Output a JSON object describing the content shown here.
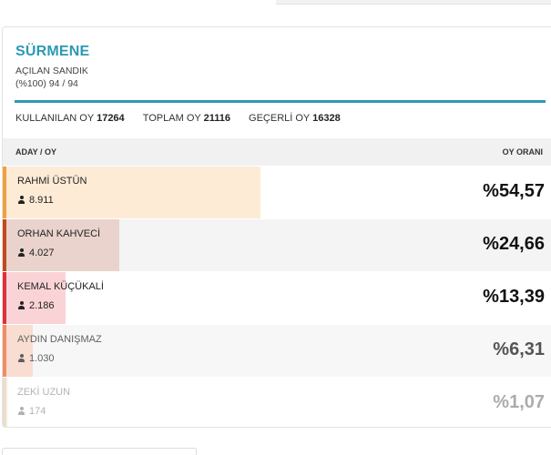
{
  "region": {
    "title": "SÜRMENE",
    "subtitle": "AÇILAN SANDIK",
    "ballot_progress": "(%100) 94 / 94"
  },
  "stats": {
    "used_label": "KULLANILAN OY",
    "used_value": "17264",
    "total_label": "TOPLAM OY",
    "total_value": "21116",
    "valid_label": "GEÇERLİ OY",
    "valid_value": "16328"
  },
  "table": {
    "col_left": "ADAY / OY",
    "col_right": "OY ORANI",
    "rows": [
      {
        "name": "RAHMİ ÜSTÜN",
        "votes": "8.911",
        "percent": "%54,57",
        "share": 54.57,
        "accent": "#f0a040",
        "bar": "#fdebd6"
      },
      {
        "name": "ORHAN KAHVECİ",
        "votes": "4.027",
        "percent": "%24,66",
        "share": 24.66,
        "accent": "#c24a1c",
        "bar": "#ead3cc"
      },
      {
        "name": "KEMAL KÜÇÜKALİ",
        "votes": "2.186",
        "percent": "%13,39",
        "share": 13.39,
        "accent": "#e0303c",
        "bar": "#fad3d6"
      },
      {
        "name": "AYDIN DANIŞMAZ",
        "votes": "1.030",
        "percent": "%6,31",
        "share": 6.31,
        "accent": "#e8642c",
        "bar": "#f8d0c0"
      },
      {
        "name": "ZEKİ UZUN",
        "votes": "174",
        "percent": "%1,07",
        "share": 1.07,
        "accent": "#c8a070",
        "bar": "#efe2d2"
      }
    ]
  }
}
